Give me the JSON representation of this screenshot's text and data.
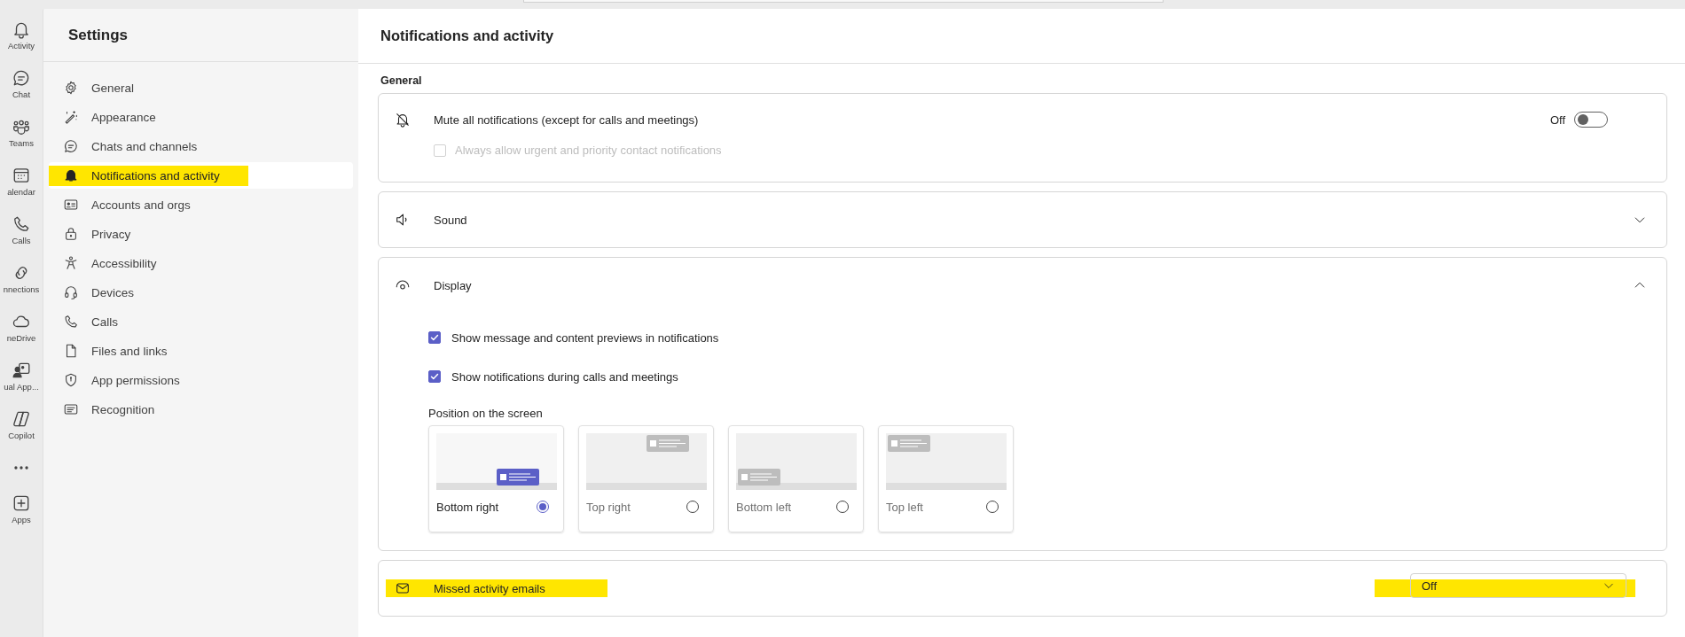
{
  "rail": [
    {
      "kind": "app",
      "label": "Activity"
    },
    {
      "kind": "app",
      "label": "Chat"
    },
    {
      "kind": "app",
      "label": "Teams"
    },
    {
      "kind": "app",
      "label": "alendar"
    },
    {
      "kind": "app",
      "label": "Calls"
    },
    {
      "kind": "app",
      "label": "nnections"
    },
    {
      "kind": "app",
      "label": "neDrive"
    },
    {
      "kind": "app",
      "label": "ual App..."
    },
    {
      "kind": "app",
      "label": "Copilot"
    },
    {
      "kind": "more"
    },
    {
      "kind": "app",
      "label": "Apps"
    }
  ],
  "sidebar": {
    "title": "Settings",
    "items": [
      {
        "label": "General",
        "selected": false,
        "highlighted": false
      },
      {
        "label": "Appearance",
        "selected": false,
        "highlighted": false
      },
      {
        "label": "Chats and channels",
        "selected": false,
        "highlighted": false
      },
      {
        "label": "Notifications and activity",
        "selected": true,
        "highlighted": true
      },
      {
        "label": "Accounts and orgs",
        "selected": false,
        "highlighted": false
      },
      {
        "label": "Privacy",
        "selected": false,
        "highlighted": false
      },
      {
        "label": "Accessibility",
        "selected": false,
        "highlighted": false
      },
      {
        "label": "Devices",
        "selected": false,
        "highlighted": false
      },
      {
        "label": "Calls",
        "selected": false,
        "highlighted": false
      },
      {
        "label": "Files and links",
        "selected": false,
        "highlighted": false
      },
      {
        "label": "App permissions",
        "selected": false,
        "highlighted": false
      },
      {
        "label": "Recognition",
        "selected": false,
        "highlighted": false
      }
    ]
  },
  "page": {
    "title": "Notifications and activity",
    "section_label": "General",
    "mute": {
      "label": "Mute all notifications (except for calls and meetings)",
      "state_text": "Off",
      "on": false,
      "option": {
        "label": "Always allow urgent and priority contact notifications",
        "checked": false,
        "disabled": true
      }
    },
    "sound": {
      "label": "Sound",
      "expanded": false
    },
    "display": {
      "label": "Display",
      "expanded": true,
      "options": [
        {
          "label": "Show message and content previews in notifications",
          "checked": true
        },
        {
          "label": "Show notifications during calls and meetings",
          "checked": true
        }
      ],
      "position_label": "Position on the screen",
      "positions": [
        {
          "label": "Bottom right",
          "selected": true
        },
        {
          "label": "Top right",
          "selected": false
        },
        {
          "label": "Bottom left",
          "selected": false
        },
        {
          "label": "Top left",
          "selected": false
        }
      ]
    },
    "missed": {
      "label": "Missed activity emails",
      "highlighted": true,
      "dropdown": {
        "value": "Off",
        "highlighted": true
      }
    }
  }
}
